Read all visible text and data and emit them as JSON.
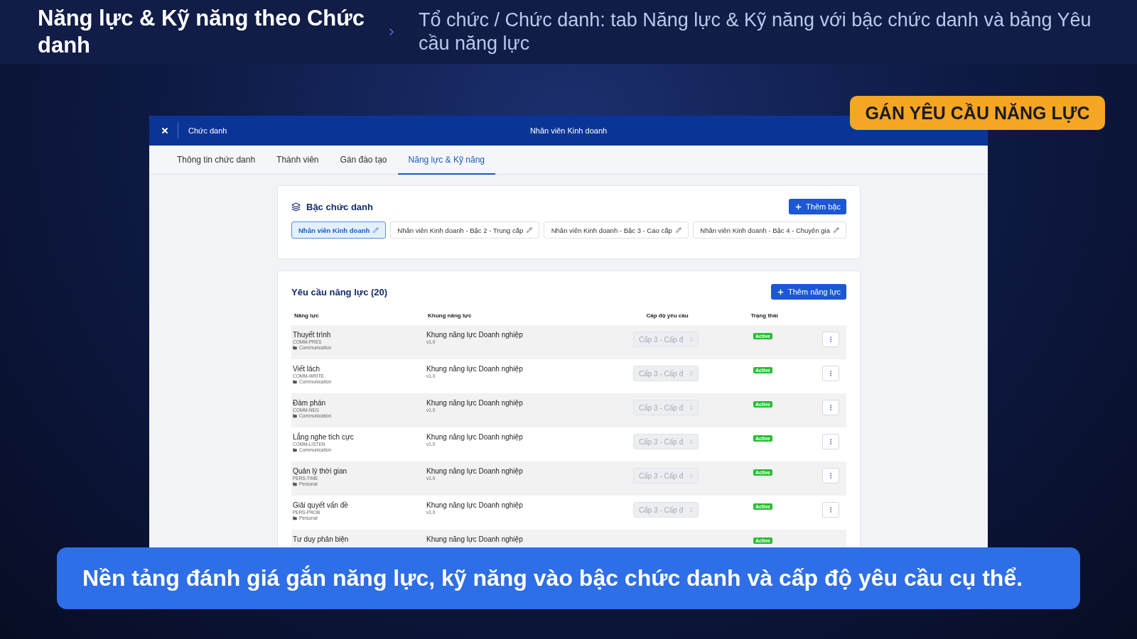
{
  "slide_header": {
    "title": "Năng lực & Kỹ năng theo Chức danh",
    "subtitle": "Tổ chức / Chức danh: tab Năng lực & Kỹ năng với bậc chức danh và bảng Yêu cầu năng lực"
  },
  "badge": "GÁN YÊU CẦU NĂNG LỰC",
  "window": {
    "breadcrumb": "Chức danh",
    "title": "Nhân viên Kinh doanh"
  },
  "tabs": [
    {
      "label": "Thông tin chức danh",
      "selected": false
    },
    {
      "label": "Thành viên",
      "selected": false
    },
    {
      "label": "Gán đào tạo",
      "selected": false
    },
    {
      "label": "Năng lực & Kỹ năng",
      "selected": true
    }
  ],
  "tiers": {
    "title": "Bậc chức danh",
    "add_button": "Thêm bậc",
    "items": [
      {
        "label": "Nhân viên Kinh doanh",
        "selected": true
      },
      {
        "label": "Nhân viên Kinh doanh - Bậc 2 - Trung cấp",
        "selected": false
      },
      {
        "label": "Nhân viên Kinh doanh - Bậc 3 - Cao cấp",
        "selected": false
      },
      {
        "label": "Nhân viên Kinh doanh - Bậc 4 - Chuyên gia",
        "selected": false
      }
    ]
  },
  "requirements": {
    "title": "Yêu cầu năng lực (20)",
    "add_button": "Thêm năng lực",
    "columns": [
      "Năng lực",
      "Khung năng lực",
      "Cấp độ yêu cầu",
      "Trạng thái"
    ],
    "rows": [
      {
        "name": "Thuyết trình",
        "code": "COMM-PRES",
        "category": "Communication",
        "framework": "Khung năng lực Doanh nghiệp",
        "version": "v1.0",
        "level": {
          "value": "Cấp 3 - Cấp đ",
          "disabled": true
        },
        "status": "Active",
        "color": "#22c02e"
      },
      {
        "name": "Viết lách",
        "code": "COMM-WRITE",
        "category": "Communication",
        "framework": "Khung năng lực Doanh nghiệp",
        "version": "v1.0",
        "level": {
          "value": "Cấp 3 - Cấp đ",
          "disabled": true
        },
        "status": "Active",
        "color": "#22c02e"
      },
      {
        "name": "Đàm phán",
        "code": "COMM-NEG",
        "category": "Communication",
        "framework": "Khung năng lực Doanh nghiệp",
        "version": "v1.0",
        "level": {
          "value": "Cấp 3 - Cấp đ",
          "disabled": true
        },
        "status": "Active",
        "color": "#22c02e"
      },
      {
        "name": "Lắng nghe tích cực",
        "code": "COMM-LISTEN",
        "category": "Communication",
        "framework": "Khung năng lực Doanh nghiệp",
        "version": "v1.0",
        "level": {
          "value": "Cấp 3 - Cấp đ",
          "disabled": true
        },
        "status": "Active",
        "color": "#22c02e"
      },
      {
        "name": "Quản lý thời gian",
        "code": "PERS-TIME",
        "category": "Personal",
        "framework": "Khung năng lực Doanh nghiệp",
        "version": "v1.0",
        "level": {
          "value": "Cấp 3 - Cấp đ",
          "disabled": true
        },
        "status": "Active",
        "color": "#22c02e"
      },
      {
        "name": "Giải quyết vấn đề",
        "code": "PERS-PROB",
        "category": "Personal",
        "framework": "Khung năng lực Doanh nghiệp",
        "version": "v1.0",
        "level": {
          "value": "Cấp 3 - Cấp đ",
          "disabled": true
        },
        "status": "Active",
        "color": "#22c02e"
      },
      {
        "name": "Tư duy phản biện",
        "framework": "Khung năng lực Doanh nghiệp",
        "status": "Active",
        "color": "#22c02e"
      }
    ]
  },
  "caption": "Nền tảng đánh giá gắn năng lực, kỹ năng vào bậc chức danh và cấp độ yêu cầu cụ thể."
}
